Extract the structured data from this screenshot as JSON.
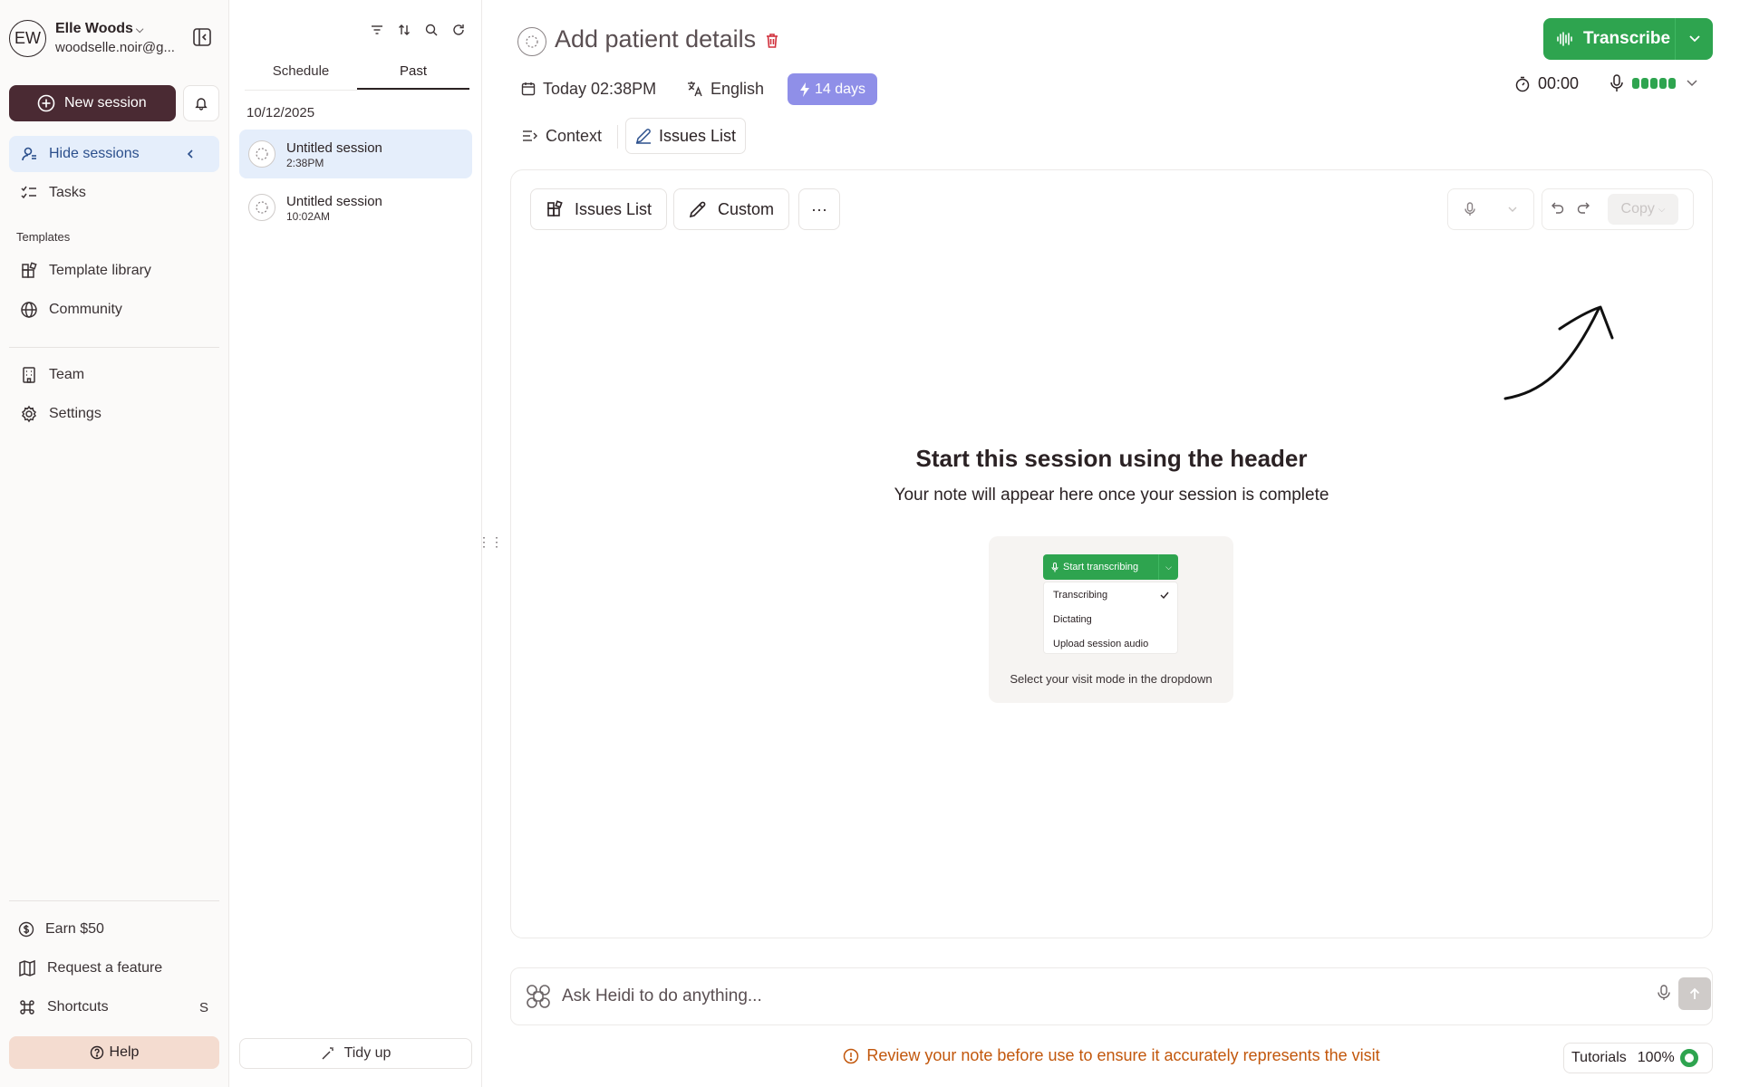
{
  "user": {
    "initials": "EW",
    "name": "Elle Woods",
    "email": "woodselle.noir@g..."
  },
  "nav": {
    "new_session": "New session",
    "hide_sessions": "Hide sessions",
    "tasks": "Tasks",
    "templates_section": "Templates",
    "template_library": "Template library",
    "community": "Community",
    "team": "Team",
    "settings": "Settings",
    "earn": "Earn $50",
    "request_feature": "Request a feature",
    "shortcuts": "Shortcuts",
    "shortcuts_key": "S",
    "help": "Help"
  },
  "sessions": {
    "tabs": [
      "Schedule",
      "Past"
    ],
    "active_tab": "Past",
    "date": "10/12/2025",
    "items": [
      {
        "title": "Untitled session",
        "time": "2:38PM"
      },
      {
        "title": "Untitled session",
        "time": "10:02AM"
      }
    ],
    "tidy_up": "Tidy up"
  },
  "header": {
    "title": "Add patient details",
    "transcribe": "Transcribe",
    "date": "Today 02:38PM",
    "language": "English",
    "days_badge": "14 days",
    "timer": "00:00"
  },
  "view_tabs": {
    "context": "Context",
    "issues_list": "Issues List"
  },
  "panel": {
    "template_btn": "Issues List",
    "custom_btn": "Custom",
    "more_btn": "···",
    "copy": "Copy",
    "empty_title": "Start this session using the header",
    "empty_sub": "Your note will appear here once your session is complete",
    "hint": {
      "button": "Start transcribing",
      "options": [
        "Transcribing",
        "Dictating",
        "Upload session audio"
      ],
      "caption": "Select your visit mode in the dropdown"
    }
  },
  "ask": {
    "placeholder": "Ask Heidi to do anything..."
  },
  "footer": {
    "review": "Review your note before use to ensure it accurately represents the visit",
    "tutorials": "Tutorials",
    "progress": "100%"
  },
  "colors": {
    "brand_dark": "#4a2a33",
    "green": "#2ea44f",
    "badge_purple": "#8f8fe8",
    "warning": "#c2570c",
    "active_blue": "#e5eefb"
  },
  "icons": [
    "panel-collapse-icon",
    "plus-circle-icon",
    "bell-icon",
    "user-icon",
    "tasks-icon",
    "template-icon",
    "globe-icon",
    "team-icon",
    "gear-icon",
    "dollar-icon",
    "map-icon",
    "command-icon",
    "help-icon",
    "filter-icon",
    "sort-icon",
    "search-icon",
    "refresh-icon",
    "session-icon",
    "wand-icon",
    "trash-icon",
    "waveform-icon",
    "calendar-icon",
    "translate-icon",
    "bolt-icon",
    "stopwatch-icon",
    "mic-icon",
    "pencil-icon",
    "undo-icon",
    "redo-icon",
    "arrow-up-icon",
    "alert-icon"
  ]
}
